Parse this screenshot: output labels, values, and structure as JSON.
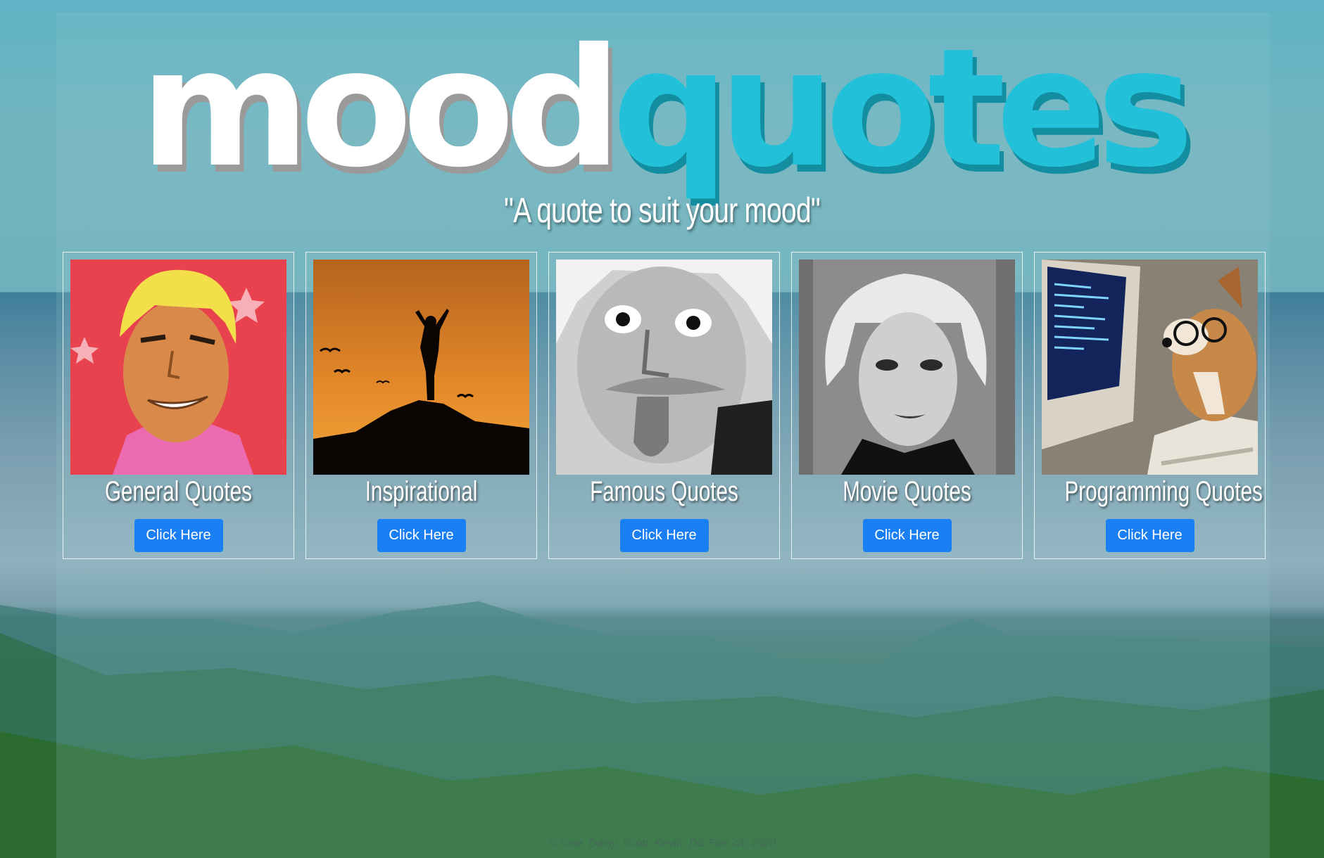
{
  "logo": {
    "part1": "mood",
    "part2": "quotes"
  },
  "tagline": "\"A quote to suit your mood\"",
  "colors": {
    "accent": "#22c1d9",
    "button": "#1a7ef5"
  },
  "cards": [
    {
      "title": "General Quotes",
      "button": "Click Here"
    },
    {
      "title": "Inspirational",
      "button": "Click Here"
    },
    {
      "title": "Famous Quotes",
      "button": "Click Here"
    },
    {
      "title": "Movie Quotes",
      "button": "Click Here"
    },
    {
      "title": "Programming Quotes",
      "button": "Click Here"
    }
  ],
  "footer": "© Cole, Daisy, Scott, Kevin. DC Flex c/o 2020"
}
